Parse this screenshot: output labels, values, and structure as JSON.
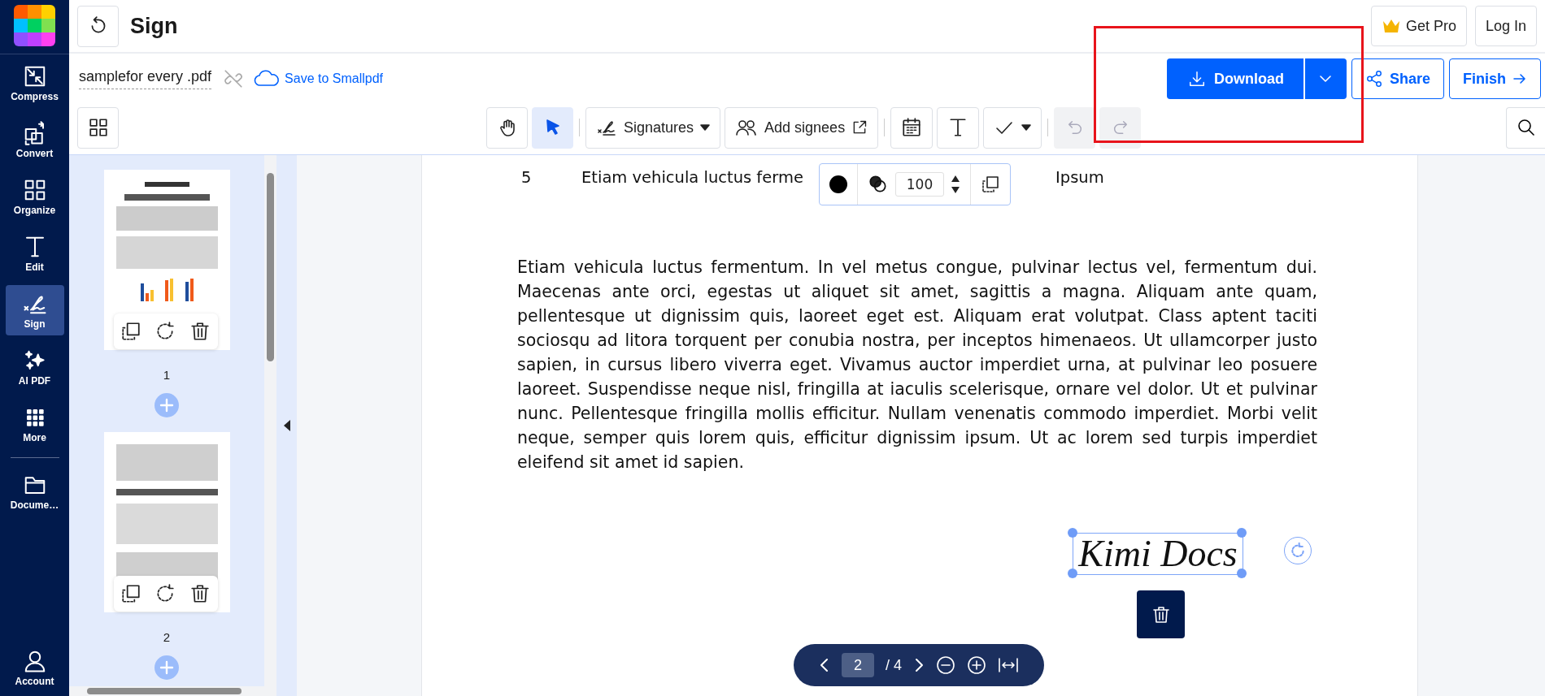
{
  "sidebar": {
    "items": [
      {
        "label": "Compress",
        "selected": false
      },
      {
        "label": "Convert",
        "selected": false
      },
      {
        "label": "Organize",
        "selected": false
      },
      {
        "label": "Edit",
        "selected": false
      },
      {
        "label": "Sign",
        "selected": true
      },
      {
        "label": "AI PDF",
        "selected": false
      },
      {
        "label": "More",
        "selected": false
      },
      {
        "label": "Docume…",
        "selected": false
      }
    ],
    "account": "Account"
  },
  "header": {
    "title": "Sign",
    "get_pro": "Get Pro",
    "log_in": "Log In"
  },
  "file": {
    "name": "samplefor every .pdf",
    "save_link": "Save to Smallpdf"
  },
  "actions": {
    "download": "Download",
    "share": "Share",
    "finish": "Finish"
  },
  "toolbar": {
    "tools": [
      {
        "kind": "hand",
        "selected": false,
        "disabled": false
      },
      {
        "kind": "pointer",
        "selected": true,
        "disabled": false
      },
      {
        "kind": "signatures",
        "label": "Signatures",
        "selected": false,
        "disabled": false
      },
      {
        "kind": "signees",
        "label": "Add signees",
        "selected": false,
        "disabled": false
      },
      {
        "kind": "date",
        "selected": false,
        "disabled": false
      },
      {
        "kind": "text",
        "selected": false,
        "disabled": false
      },
      {
        "kind": "check",
        "selected": false,
        "disabled": false
      },
      {
        "kind": "undo",
        "selected": false,
        "disabled": true
      },
      {
        "kind": "redo",
        "selected": false,
        "disabled": true
      }
    ]
  },
  "thumbnails": [
    {
      "label": "1",
      "kind": "picture"
    },
    {
      "label": "2",
      "kind": "picture"
    }
  ],
  "document": {
    "row": {
      "number": "5",
      "text": "Etiam vehicula luctus ferme",
      "last": "Ipsum"
    },
    "paragraph": "Etiam vehicula luctus fermentum. In vel metus congue, pulvinar lectus vel, fermentum dui. Maecenas ante orci, egestas ut aliquet sit amet, sagittis a magna. Aliquam ante quam, pellentesque ut dignissim quis, laoreet eget est. Aliquam erat volutpat. Class aptent taciti sociosqu ad litora torquent per conubia nostra, per inceptos himenaeos. Ut ullamcorper justo sapien, in cursus libero viverra eget. Vivamus auctor imperdiet urna, at pulvinar leo posuere laoreet. Suspendisse neque nisl, fringilla at iaculis scelerisque, ornare vel dolor. Ut et pulvinar nunc. Pellentesque fringilla mollis efficitur. Nullam venenatis commodo imperdiet. Morbi velit neque, semper quis lorem quis, efficitur dignissim ipsum. Ut ac lorem sed turpis imperdiet eleifend sit amet id sapien.",
    "signature": "Kimi Docs"
  },
  "element_toolbar": {
    "color": "#000000",
    "opacity": "100"
  },
  "pager": {
    "page": "2",
    "total": "/ 4"
  }
}
